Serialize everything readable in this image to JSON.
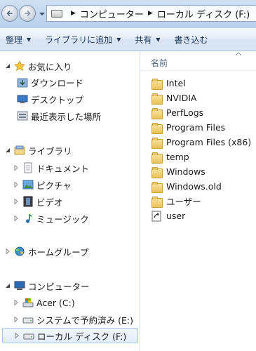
{
  "address": {
    "crumbs": [
      "コンピューター",
      "ローカル ディスク (F:)"
    ]
  },
  "toolbar": {
    "organize": "整理",
    "add_to_library": "ライブラリに追加",
    "share": "共有",
    "burn": "書き込む"
  },
  "nav": {
    "favorites": "お気に入り",
    "downloads": "ダウンロード",
    "desktop": "デスクトップ",
    "recent": "最近表示した場所",
    "libraries": "ライブラリ",
    "documents": "ドキュメント",
    "pictures": "ピクチャ",
    "videos": "ビデオ",
    "music": "ミュージック",
    "homegroup": "ホームグループ",
    "computer": "コンピューター",
    "drive_c": "Acer (C:)",
    "drive_e": "システムで予約済み (E:)",
    "drive_f": "ローカル ディスク (F:)"
  },
  "main": {
    "column_name": "名前",
    "items": [
      {
        "label": "Intel",
        "icon": "folder"
      },
      {
        "label": "NVIDIA",
        "icon": "folder"
      },
      {
        "label": "PerfLogs",
        "icon": "folder"
      },
      {
        "label": "Program Files",
        "icon": "folder"
      },
      {
        "label": "Program Files (x86)",
        "icon": "folder"
      },
      {
        "label": "temp",
        "icon": "folder"
      },
      {
        "label": "Windows",
        "icon": "folder"
      },
      {
        "label": "Windows.old",
        "icon": "folder"
      },
      {
        "label": "ユーザー",
        "icon": "folder"
      },
      {
        "label": "user",
        "icon": "file"
      }
    ]
  },
  "colors": {
    "toolbar_text": "#1e395b",
    "selection_border": "#a9c7ee",
    "folder_fill": "#e9c25a"
  }
}
